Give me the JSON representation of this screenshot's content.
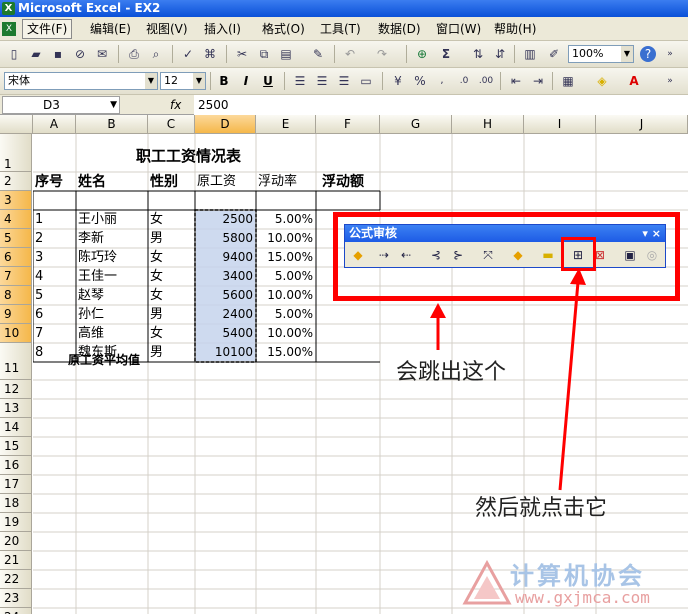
{
  "title": "Microsoft Excel - EX2",
  "menu": [
    "文件(F)",
    "编辑(E)",
    "视图(V)",
    "插入(I)",
    "格式(O)",
    "工具(T)",
    "数据(D)",
    "窗口(W)",
    "帮助(H)"
  ],
  "toolbar": {
    "zoom": "100%",
    "font": "宋体",
    "size": "12",
    "bold": "B",
    "italic": "I",
    "underline": "U"
  },
  "formula_bar": {
    "name_box": "D3",
    "fx": "fx",
    "value": "2500"
  },
  "columns": [
    "A",
    "B",
    "C",
    "D",
    "E",
    "F",
    "G",
    "H",
    "I",
    "J"
  ],
  "rows": [
    "1",
    "2",
    "3",
    "4",
    "5",
    "6",
    "7",
    "8",
    "9",
    "10",
    "11",
    "12",
    "13",
    "14",
    "15",
    "16",
    "17",
    "18",
    "19",
    "20",
    "21",
    "22",
    "23",
    "24"
  ],
  "sheet": {
    "title": "职工工资情况表",
    "headers": [
      "序号",
      "姓名",
      "性别",
      "原工资",
      "浮动率",
      "浮动额"
    ],
    "data": [
      [
        "1",
        "王小丽",
        "女",
        "2500",
        "5.00%"
      ],
      [
        "2",
        "李新",
        "男",
        "5800",
        "10.00%"
      ],
      [
        "3",
        "陈巧玲",
        "女",
        "9400",
        "15.00%"
      ],
      [
        "4",
        "王佳一",
        "女",
        "3400",
        "5.00%"
      ],
      [
        "5",
        "赵琴",
        "女",
        "5600",
        "10.00%"
      ],
      [
        "6",
        "孙仁",
        "男",
        "2400",
        "5.00%"
      ],
      [
        "7",
        "高维",
        "女",
        "5400",
        "10.00%"
      ],
      [
        "8",
        "魏东斯",
        "男",
        "10100",
        "15.00%"
      ]
    ],
    "avg_label": "原工资平均值"
  },
  "audit_toolbar": {
    "title": "公式审核",
    "controls": "▾ ×"
  },
  "annotations": {
    "popup": "会跳出这个",
    "click": "然后就点击它"
  },
  "watermark": {
    "name": "计算机协会",
    "url": "www.gxjmca.com"
  }
}
